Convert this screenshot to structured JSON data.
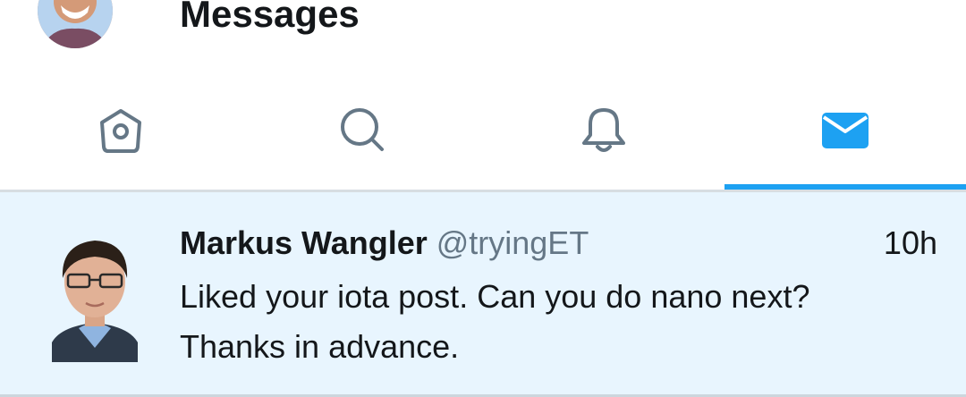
{
  "header": {
    "title": "Messages",
    "avatar_icon": "profile-avatar"
  },
  "tabs": [
    {
      "name": "Home",
      "icon": "home-icon",
      "active": false
    },
    {
      "name": "Search",
      "icon": "search-icon",
      "active": false
    },
    {
      "name": "Notifications",
      "icon": "bell-icon",
      "active": false
    },
    {
      "name": "Messages",
      "icon": "mail-icon",
      "active": true
    }
  ],
  "conversation": {
    "sender_name": "Markus Wangler",
    "sender_handle": "@tryingET",
    "timestamp": "10h",
    "message": "Liked your iota post. Can you do nano next? Thanks in advance."
  },
  "colors": {
    "accent": "#1da1f2",
    "icon_inactive": "#657786",
    "text_primary": "#14171a",
    "text_secondary": "#657786",
    "unread_background": "#e8f5fe"
  }
}
